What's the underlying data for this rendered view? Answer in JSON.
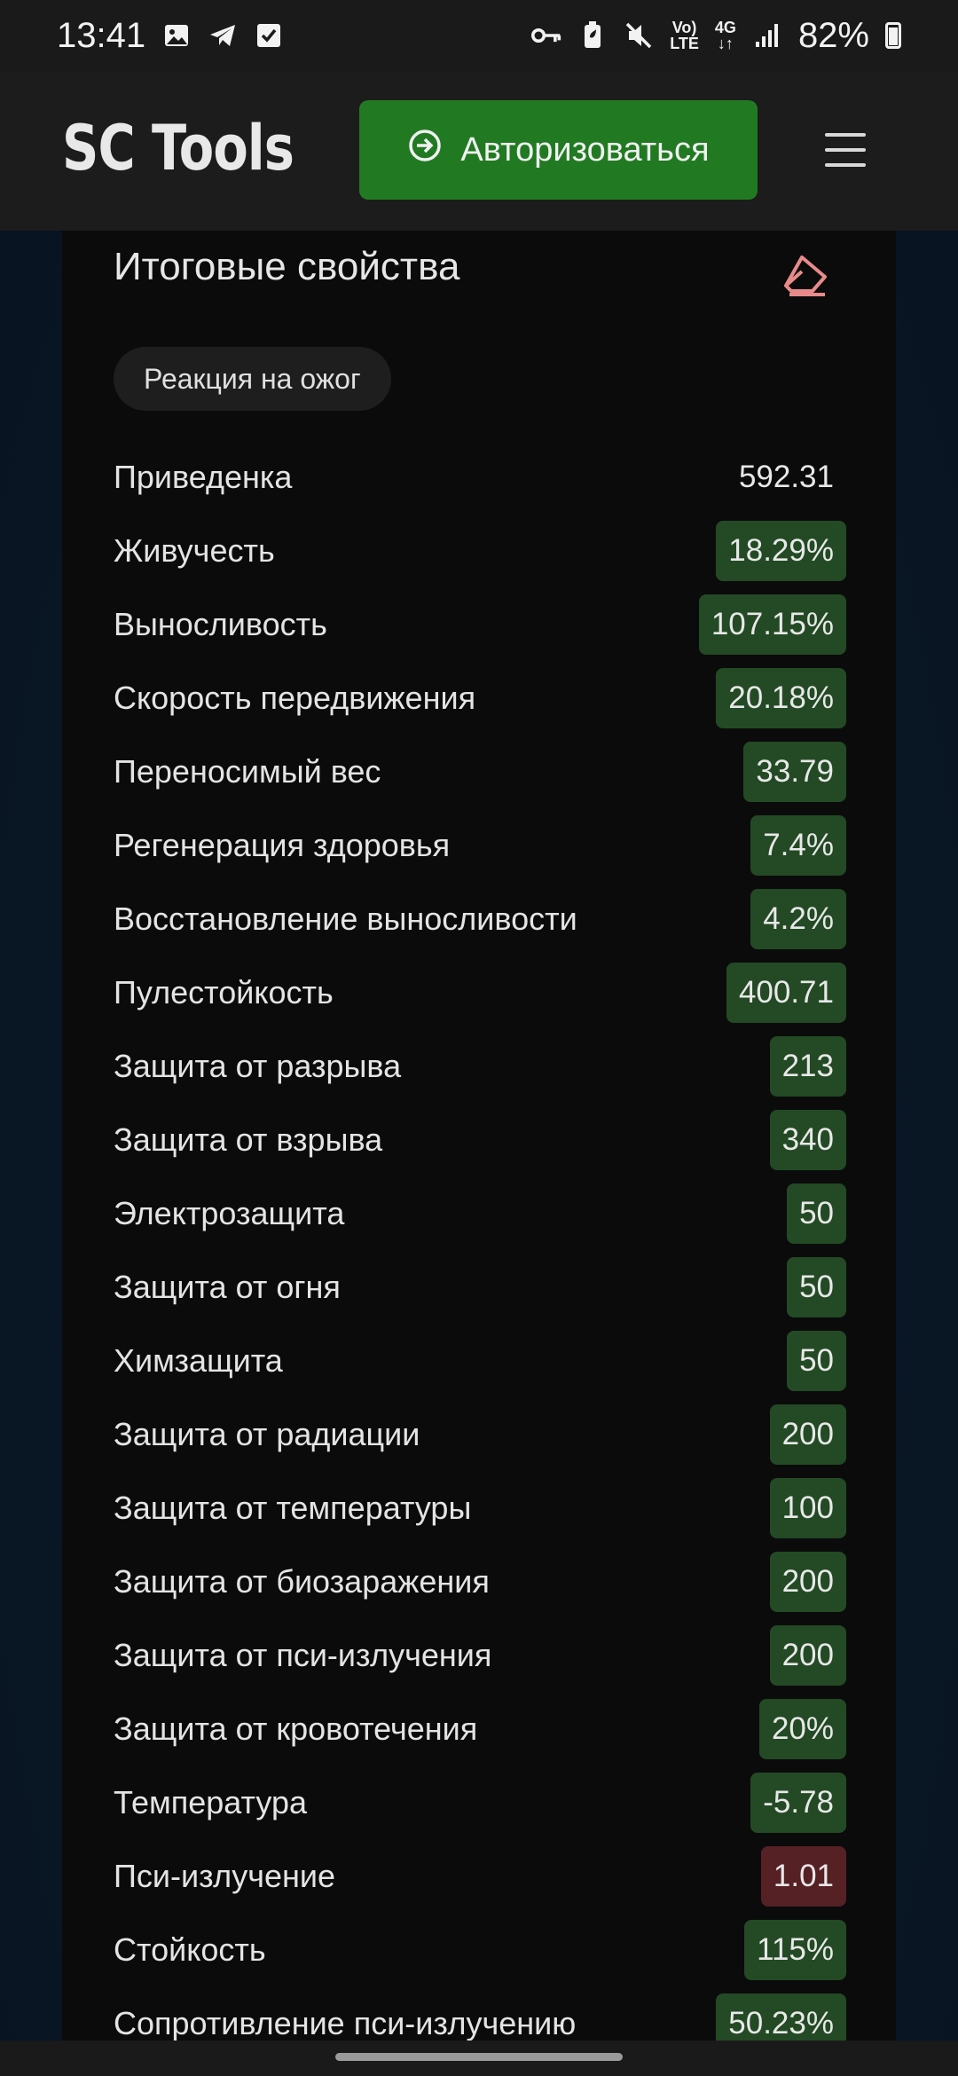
{
  "status_bar": {
    "time": "13:41",
    "network_top": "4G",
    "volte_top": "Vo)",
    "volte_bottom": "LTE",
    "battery": "82%"
  },
  "header": {
    "logo": "SC Tools",
    "auth_label": "Авторизоваться"
  },
  "panel": {
    "title": "Итоговые свойства",
    "chip": "Реакция на ожог"
  },
  "stats": [
    {
      "label": "Приведенка",
      "value": "592.31",
      "style": "plain"
    },
    {
      "label": "Живучесть",
      "value": "18.29%",
      "style": "green"
    },
    {
      "label": "Выносливость",
      "value": "107.15%",
      "style": "green"
    },
    {
      "label": "Скорость передвижения",
      "value": "20.18%",
      "style": "green"
    },
    {
      "label": "Переносимый вес",
      "value": "33.79",
      "style": "green"
    },
    {
      "label": "Регенерация здоровья",
      "value": "7.4%",
      "style": "green"
    },
    {
      "label": "Восстановление выносливости",
      "value": "4.2%",
      "style": "green"
    },
    {
      "label": "Пулестойкость",
      "value": "400.71",
      "style": "green"
    },
    {
      "label": "Защита от разрыва",
      "value": "213",
      "style": "green"
    },
    {
      "label": "Защита от взрыва",
      "value": "340",
      "style": "green"
    },
    {
      "label": "Электрозащита",
      "value": "50",
      "style": "green"
    },
    {
      "label": "Защита от огня",
      "value": "50",
      "style": "green"
    },
    {
      "label": "Химзащита",
      "value": "50",
      "style": "green"
    },
    {
      "label": "Защита от радиации",
      "value": "200",
      "style": "green"
    },
    {
      "label": "Защита от температуры",
      "value": "100",
      "style": "green"
    },
    {
      "label": "Защита от биозаражения",
      "value": "200",
      "style": "green"
    },
    {
      "label": "Защита от пси-излучения",
      "value": "200",
      "style": "green"
    },
    {
      "label": "Защита от кровотечения",
      "value": "20%",
      "style": "green"
    },
    {
      "label": "Температура",
      "value": "-5.78",
      "style": "green"
    },
    {
      "label": "Пси-излучение",
      "value": "1.01",
      "style": "red"
    },
    {
      "label": "Стойкость",
      "value": "115%",
      "style": "green"
    },
    {
      "label": "Сопротивление пси-излучению",
      "value": "50.23%",
      "style": "green"
    }
  ],
  "colors": {
    "positive": "#234a24",
    "negative": "#562124",
    "accent_button": "#217a22",
    "eraser": "#e88a8a"
  }
}
